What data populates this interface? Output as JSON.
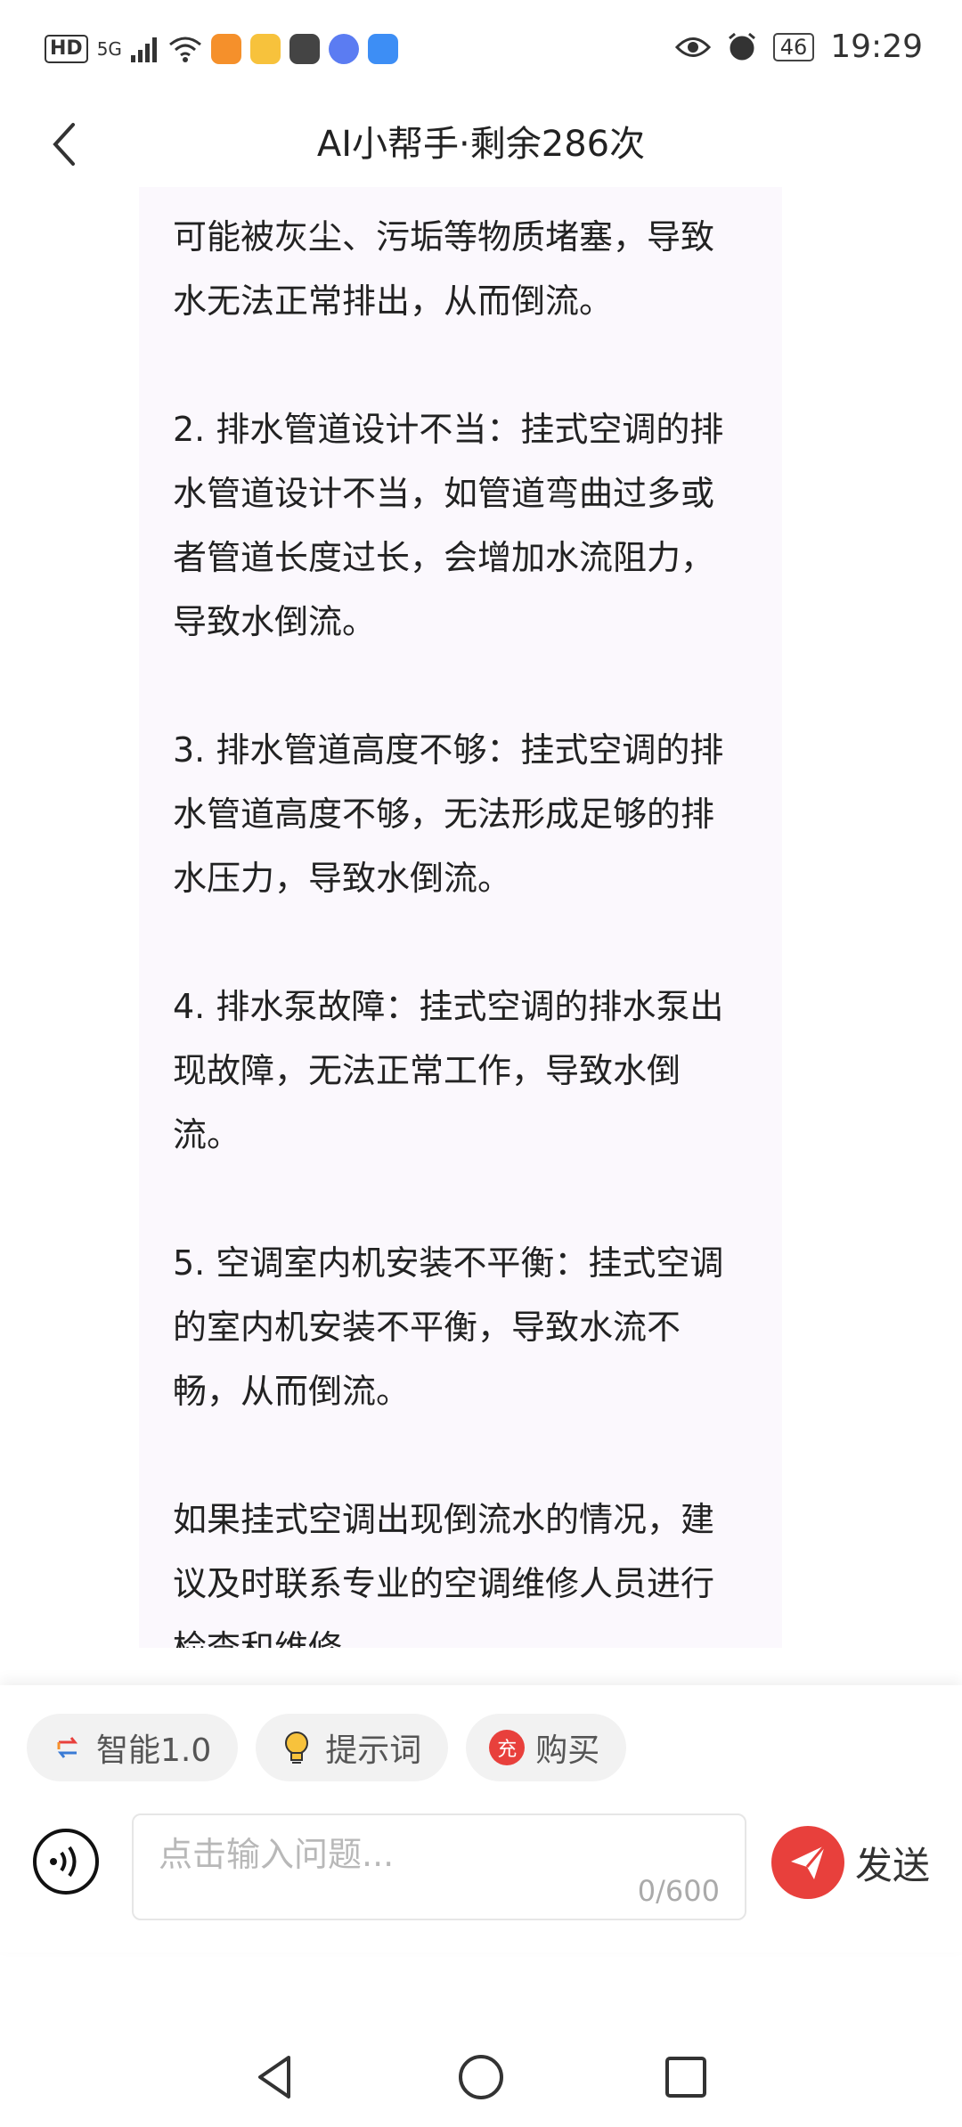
{
  "status_bar": {
    "hd": "HD",
    "signal": "5G",
    "battery": "46",
    "time": "19:29",
    "app_icons": [
      "huawei-health-icon",
      "notes-icon",
      "bag-icon",
      "music-icon",
      "cloud-icon"
    ]
  },
  "header": {
    "title": "AI小帮手·剩余286次"
  },
  "chat": {
    "message": "可能被灰尘、污垢等物质堵塞，导致水无法正常排出，从而倒流。\n\n2. 排水管道设计不当：挂式空调的排水管道设计不当，如管道弯曲过多或者管道长度过长，会增加水流阻力，导致水倒流。\n\n3. 排水管道高度不够：挂式空调的排水管道高度不够，无法形成足够的排水压力，导致水倒流。\n\n4. 排水泵故障：挂式空调的排水泵出现故障，无法正常工作，导致水倒流。\n\n5. 空调室内机安装不平衡：挂式空调的室内机安装不平衡，导致水流不畅，从而倒流。\n\n如果挂式空调出现倒流水的情况，建议及时联系专业的空调维修人员进行检查和维修。"
  },
  "chips": [
    {
      "label": "智能1.0",
      "icon": "model-switch-icon"
    },
    {
      "label": "提示词",
      "icon": "lightbulb-icon"
    },
    {
      "label": "购买",
      "icon": "recharge-icon",
      "icon_text": "充"
    }
  ],
  "input": {
    "placeholder": "点击输入问题...",
    "value": "",
    "counter": "0/600"
  },
  "send": {
    "label": "发送"
  },
  "colors": {
    "accent": "#e8403c",
    "bubble_bg": "#fbf8fd"
  }
}
